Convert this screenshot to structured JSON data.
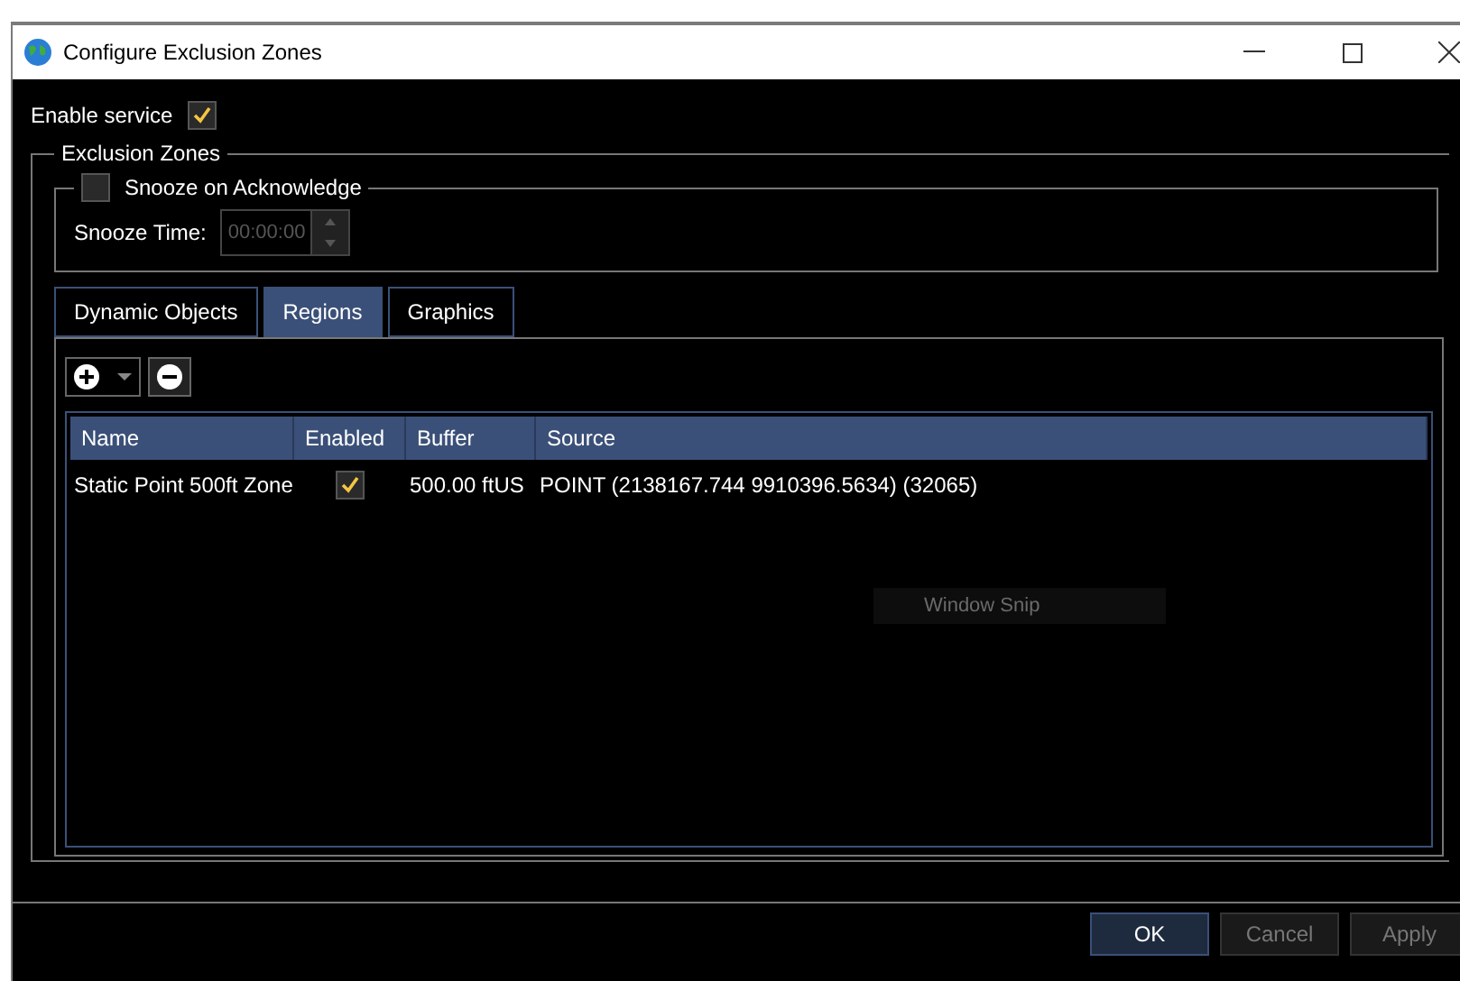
{
  "window": {
    "title": "Configure Exclusion Zones"
  },
  "enable_service": {
    "label": "Enable service",
    "checked": true
  },
  "exclusion_zones": {
    "title": "Exclusion Zones",
    "snooze": {
      "label": "Snooze on Acknowledge",
      "checked": false,
      "time_label": "Snooze Time:",
      "time_value": "00:00:00",
      "disabled": true
    },
    "tabs": [
      {
        "label": "Dynamic Objects",
        "selected": false
      },
      {
        "label": "Regions",
        "selected": true
      },
      {
        "label": "Graphics",
        "selected": false
      }
    ],
    "table": {
      "columns": [
        "Name",
        "Enabled",
        "Buffer",
        "Source"
      ],
      "rows": [
        {
          "name": "Static Point 500ft Zone",
          "enabled": true,
          "buffer": "500.00 ftUS",
          "source": "POINT (2138167.744 9910396.5634) (32065)"
        }
      ]
    }
  },
  "overlay_tooltip": "Window Snip",
  "buttons": [
    {
      "label": "OK",
      "disabled": false
    },
    {
      "label": "Cancel",
      "disabled": true
    },
    {
      "label": "Apply",
      "disabled": true
    }
  ]
}
